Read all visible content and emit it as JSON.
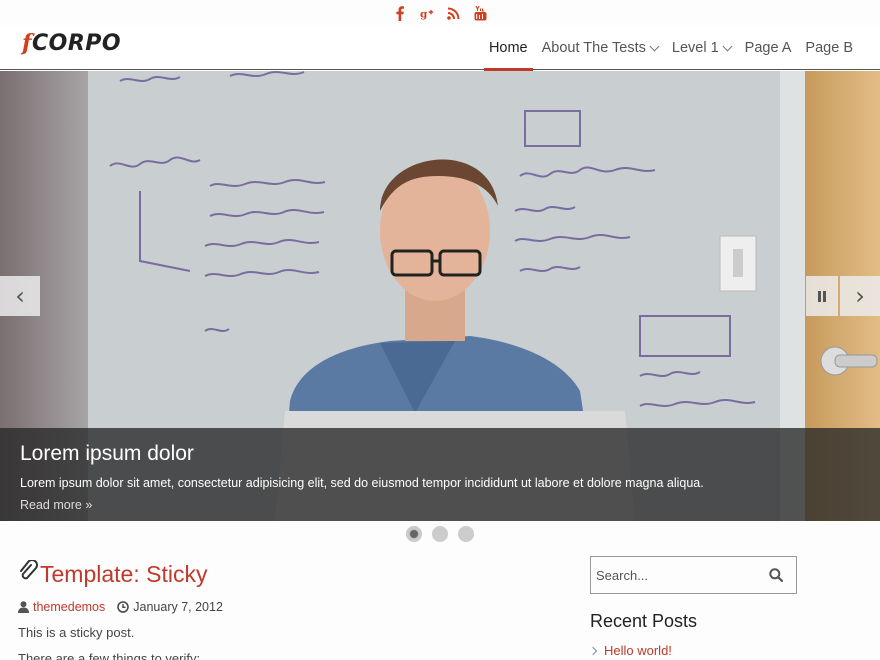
{
  "social": {
    "icons": [
      "facebook-icon",
      "google-plus-icon",
      "rss-icon",
      "youtube-icon"
    ],
    "color": "#d0401f"
  },
  "header": {
    "logo_mark": "f",
    "logo_text": "CORPO",
    "nav": [
      {
        "label": "Home",
        "active": true
      },
      {
        "label": "About The Tests",
        "dropdown": true
      },
      {
        "label": "Level 1",
        "dropdown": true
      },
      {
        "label": "Page A"
      },
      {
        "label": "Page B"
      }
    ]
  },
  "slider": {
    "title": "Lorem ipsum dolor",
    "text": "Lorem ipsum dolor sit amet, consectetur adipisicing elit, sed do eiusmod tempor incididunt ut labore et dolore magna aliqua.",
    "read_more": "Read more",
    "prev_glyph": "‹",
    "next_glyph": "›",
    "slide_count": 3,
    "active_slide": 1
  },
  "post": {
    "title": "Template: Sticky",
    "author": "themedemos",
    "date": "January 7, 2012",
    "paragraphs": [
      "This is a sticky post.",
      "There are a few things to verify:"
    ]
  },
  "sidebar": {
    "search_placeholder": "Search...",
    "recent_title": "Recent Posts",
    "recent_posts": [
      "Hello world!"
    ]
  },
  "colors": {
    "accent": "#c0392b",
    "brand": "#d0401f"
  }
}
